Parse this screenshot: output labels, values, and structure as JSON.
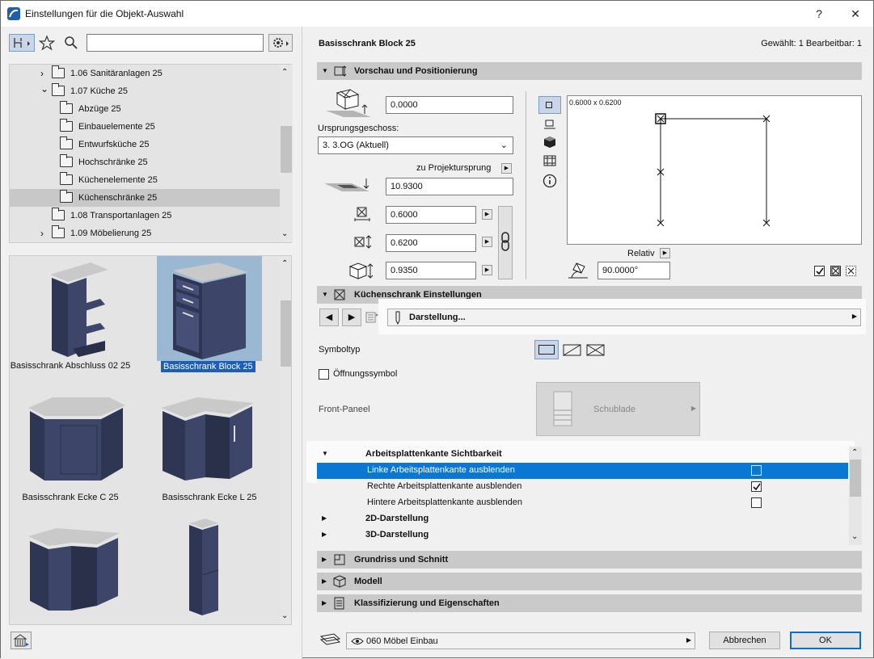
{
  "window": {
    "title": "Einstellungen für die Objekt-Auswahl",
    "help": "?",
    "close": "✕"
  },
  "left": {
    "search_value": "",
    "tree": [
      {
        "label": "1.06 Sanitäranlagen 25",
        "expand": "›",
        "level": 1
      },
      {
        "label": "1.07 Küche 25",
        "expand": "⌄",
        "level": 1
      },
      {
        "label": "Abzüge 25",
        "expand": "",
        "level": 2
      },
      {
        "label": "Einbauelemente 25",
        "expand": "",
        "level": 2
      },
      {
        "label": "Entwurfsküche 25",
        "expand": "",
        "level": 2
      },
      {
        "label": "Hochschränke 25",
        "expand": "",
        "level": 2
      },
      {
        "label": "Küchenelemente 25",
        "expand": "",
        "level": 2
      },
      {
        "label": "Küchenschränke 25",
        "expand": "",
        "level": 2,
        "selected": true
      },
      {
        "label": "1.08 Transportanlagen 25",
        "expand": "",
        "level": 1
      },
      {
        "label": "1.09 Möbelierung 25",
        "expand": "›",
        "level": 1
      }
    ],
    "thumbs": [
      {
        "label": "Basisschrank Abschluss 02 25"
      },
      {
        "label": "Basisschrank Block 25",
        "selected": true
      },
      {
        "label": "Basisschrank Ecke C 25"
      },
      {
        "label": "Basisschrank Ecke L 25"
      },
      {
        "label": ""
      },
      {
        "label": ""
      }
    ]
  },
  "right": {
    "object_name": "Basisschrank Block 25",
    "selection_info": "Gewählt: 1 Bearbeitbar: 1",
    "sec_preview": "Vorschau und Positionierung",
    "elevation": "0.0000",
    "origin_story_label": "Ursprungsgeschoss:",
    "origin_story": "3. 3.OG (Aktuell)",
    "to_project_origin": "zu Projektursprung",
    "project_elevation": "10.9300",
    "width": "0.6000",
    "depth": "0.6200",
    "height": "0.9350",
    "preview_dims": "0.6000 x 0.6200",
    "relativ": "Relativ",
    "angle": "90.0000°",
    "sec_kitchen": "Küchenschrank Einstellungen",
    "darstellung": "Darstellung...",
    "symboltyp": "Symboltyp",
    "opening_symbol": "Öffnungssymbol",
    "front_panel": "Front-Paneel",
    "schublade": "Schublade",
    "tree_header": "Arbeitsplattenkante Sichtbarkeit",
    "opt_left": "Linke Arbeitsplattenkante ausblenden",
    "opt_right": "Rechte Arbeitsplattenkante ausblenden",
    "opt_back": "Hintere Arbeitsplattenkante ausblenden",
    "sub_2d": "2D-Darstellung",
    "sub_3d": "3D-Darstellung",
    "sec_plan": "Grundriss und Schnitt",
    "sec_model": "Modell",
    "sec_class": "Klassifizierung und Eigenschaften",
    "layer": "060 Möbel Einbau",
    "cancel": "Abbrechen",
    "ok": "OK"
  }
}
